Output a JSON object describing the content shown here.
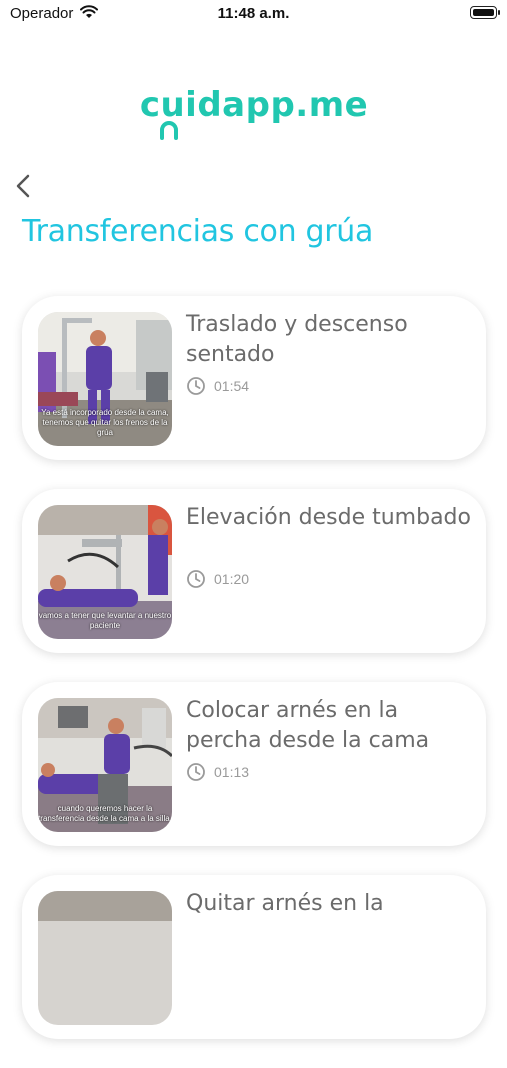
{
  "status_bar": {
    "carrier": "Operador",
    "time": "11:48 a.m."
  },
  "logo": {
    "text": "cuidapp.me"
  },
  "page": {
    "title": "Transferencias con grúa"
  },
  "videos": [
    {
      "title": "Traslado y descenso sentado",
      "duration": "01:54",
      "caption": "Ya está incorporado desde la cama, tenemos que quitar los frenos de la grúa"
    },
    {
      "title": "Elevación desde tumbado",
      "duration": "01:20",
      "caption": "vamos a tener que levantar a nuestro paciente"
    },
    {
      "title": "Colocar arnés en la percha desde la cama",
      "duration": "01:13",
      "caption": "cuando queremos hacer la transferencia desde la cama a la silla,"
    },
    {
      "title": "Quitar arnés en la",
      "duration": "",
      "caption": ""
    }
  ],
  "colors": {
    "accent": "#21c5e0",
    "logo": "#21c7b0",
    "uniform": "#5b3fa8"
  }
}
